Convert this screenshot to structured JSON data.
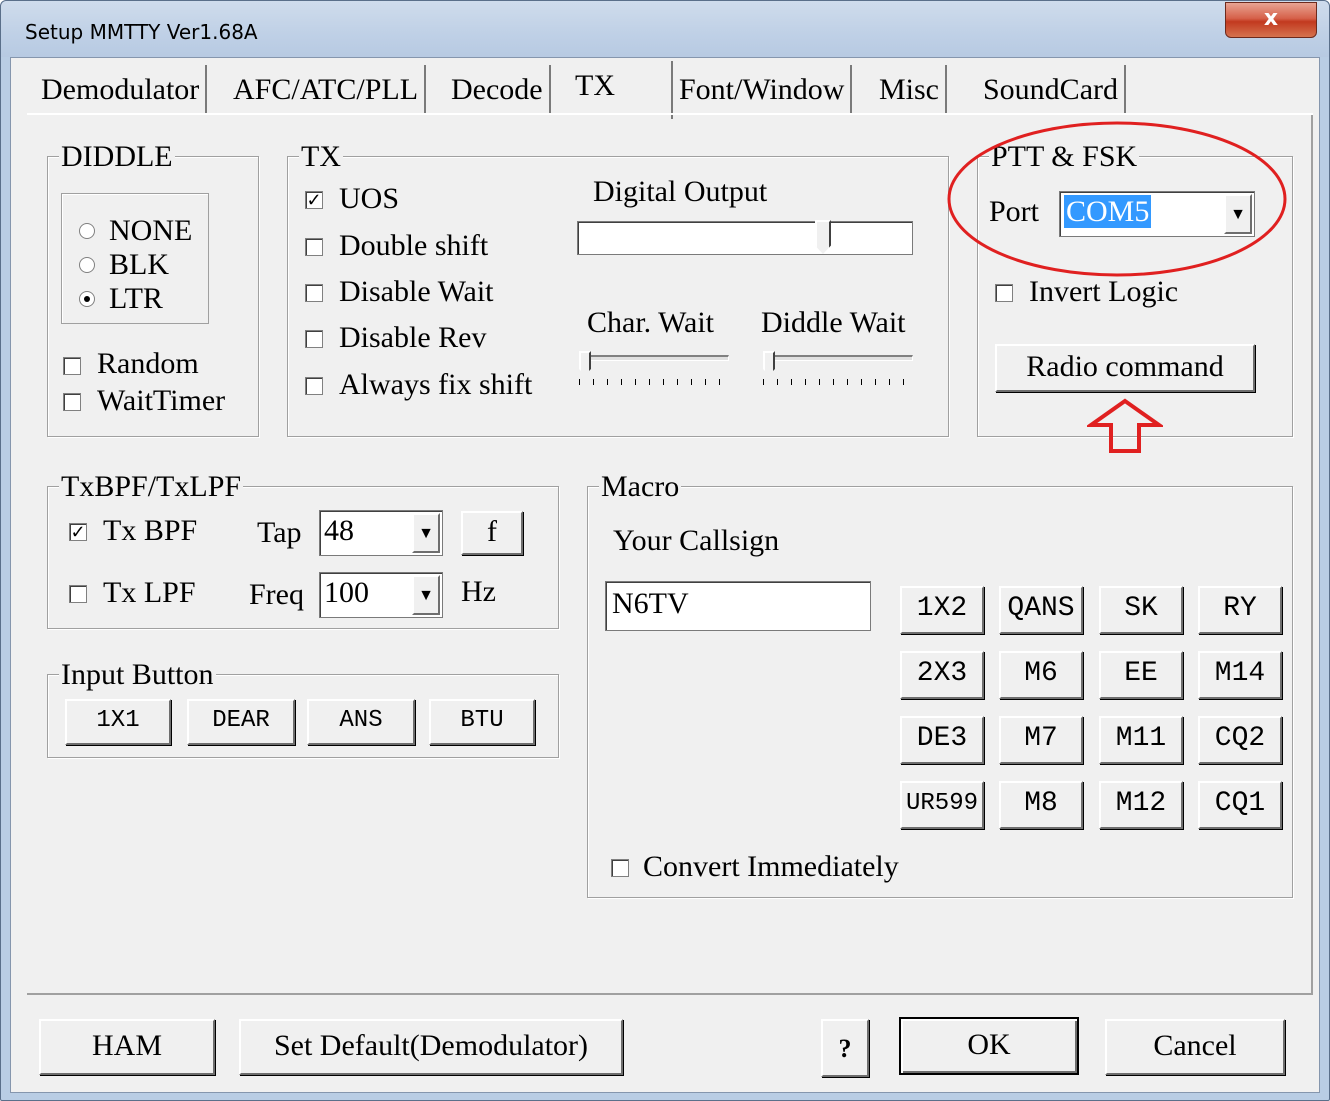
{
  "window": {
    "title": "Setup MMTTY Ver1.68A",
    "close_label": "x"
  },
  "tabs": [
    {
      "label": "Demodulator",
      "active": false
    },
    {
      "label": "AFC/ATC/PLL",
      "active": false
    },
    {
      "label": "Decode",
      "active": false
    },
    {
      "label": "TX",
      "active": true
    },
    {
      "label": "Font/Window",
      "active": false
    },
    {
      "label": "Misc",
      "active": false
    },
    {
      "label": "SoundCard",
      "active": false
    }
  ],
  "diddle": {
    "title": "DIDDLE",
    "options": [
      {
        "label": "NONE",
        "selected": false
      },
      {
        "label": "BLK",
        "selected": false
      },
      {
        "label": "LTR",
        "selected": true
      }
    ],
    "random": {
      "label": "Random",
      "checked": false
    },
    "wait_timer": {
      "label": "WaitTimer",
      "checked": false
    }
  },
  "tx": {
    "title": "TX",
    "checks": [
      {
        "label": "UOS",
        "checked": true
      },
      {
        "label": "Double shift",
        "checked": false
      },
      {
        "label": "Disable Wait",
        "checked": false
      },
      {
        "label": "Disable Rev",
        "checked": false
      },
      {
        "label": "Always fix shift",
        "checked": false
      }
    ],
    "digital_output_label": "Digital Output",
    "digital_output_level": 0.75,
    "char_wait_label": "Char. Wait",
    "char_wait_level": 0,
    "diddle_wait_label": "Diddle Wait",
    "diddle_wait_level": 0
  },
  "ptt": {
    "title": "PTT & FSK",
    "port_label": "Port",
    "port_value": "COM5",
    "invert_logic": {
      "label": "Invert Logic",
      "checked": false
    },
    "radio_command_label": "Radio command",
    "annotation_color": "#e02020"
  },
  "bpf": {
    "title": "TxBPF/TxLPF",
    "tx_bpf": {
      "label": "Tx BPF",
      "checked": true
    },
    "tx_lpf": {
      "label": "Tx LPF",
      "checked": false
    },
    "tap_label": "Tap",
    "tap_value": "48",
    "freq_label": "Freq",
    "freq_value": "100",
    "hz_label": "Hz",
    "f_button": "f"
  },
  "input_button": {
    "title": "Input Button",
    "buttons": [
      "1X1",
      "DEAR",
      "ANS",
      "BTU"
    ]
  },
  "macro": {
    "title": "Macro",
    "callsign_label": "Your Callsign",
    "callsign_value": "N6TV",
    "buttons": [
      [
        "1X2",
        "QANS",
        "SK",
        "RY"
      ],
      [
        "2X3",
        "M6",
        "EE",
        "M14"
      ],
      [
        "DE3",
        "M7",
        "M11",
        "CQ2"
      ],
      [
        "UR599",
        "M8",
        "M12",
        "CQ1"
      ]
    ],
    "convert_immediately": {
      "label": "Convert Immediately",
      "checked": false
    }
  },
  "footer": {
    "ham": "HAM",
    "set_default": "Set Default(Demodulator)",
    "help": "?",
    "ok": "OK",
    "cancel": "Cancel"
  }
}
